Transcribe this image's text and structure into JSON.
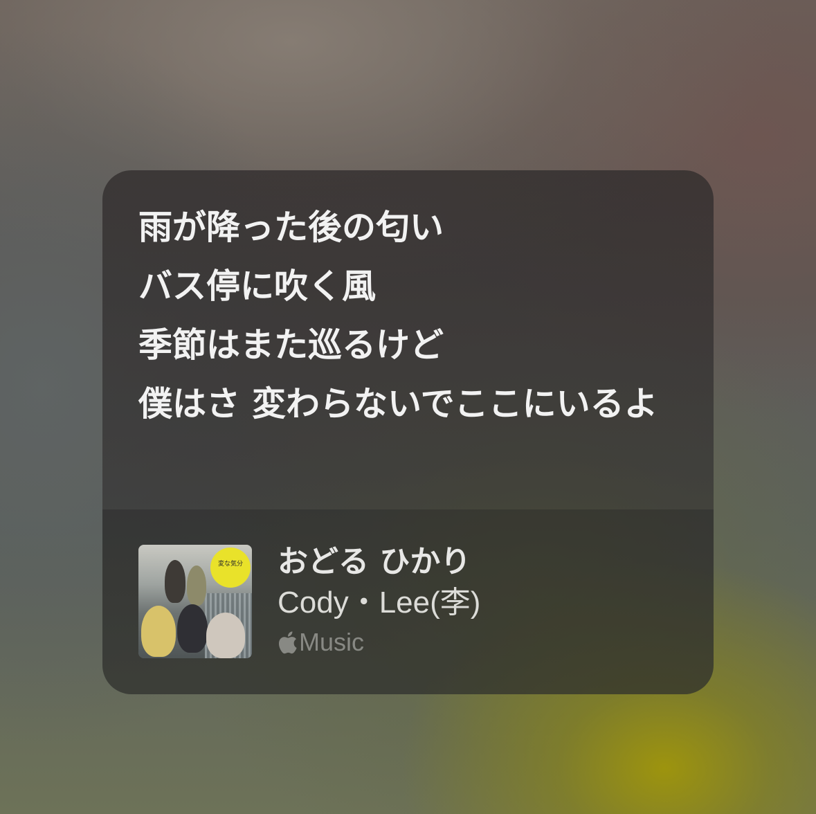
{
  "lyrics": {
    "lines": [
      "雨が降った後の匂い",
      "バス停に吹く風",
      "季節はまた巡るけど",
      "僕はさ 変わらないでここにいるよ"
    ]
  },
  "track": {
    "title": "おどる ひかり",
    "artist": "Cody・Lee(李)",
    "service_label": "Music",
    "service_icon": "apple-logo-icon",
    "artwork_badge_text": "変な気分"
  },
  "colors": {
    "lyric_text": "#f2f2f2",
    "card_bg": "#302c2c",
    "service_text": "#c8c8c4",
    "artwork_badge": "#e9e22a"
  }
}
